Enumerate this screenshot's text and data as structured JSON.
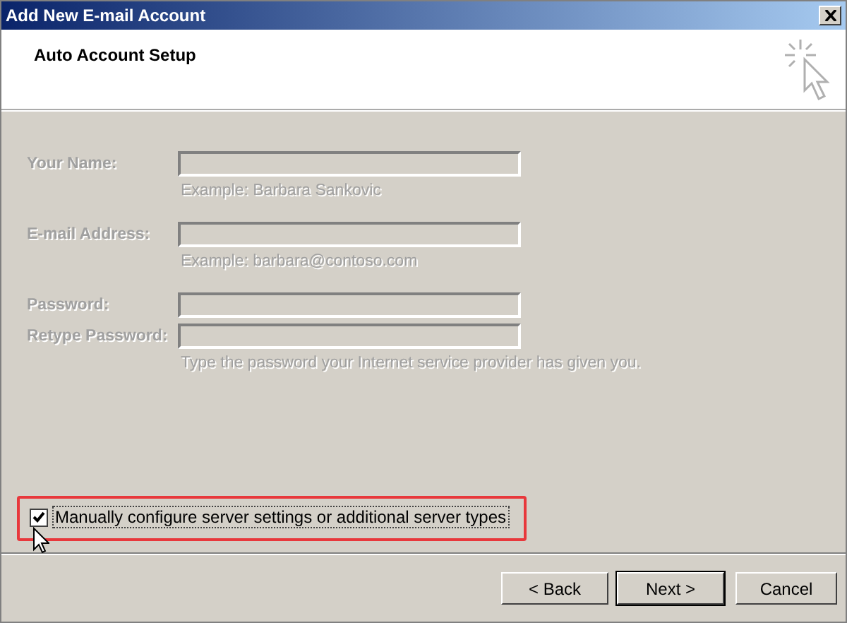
{
  "window": {
    "title": "Add New E-mail Account"
  },
  "header": {
    "title": "Auto Account Setup"
  },
  "form": {
    "disabled": true,
    "fields": [
      {
        "label": "Your Name:",
        "hint": "Example: Barbara Sankovic"
      },
      {
        "label": "E-mail Address:",
        "hint": "Example: barbara@contoso.com"
      },
      {
        "label": "Password:"
      },
      {
        "label": "Retype Password:",
        "hint": "Type the password your Internet service provider has given you."
      }
    ]
  },
  "manual_config": {
    "label": "Manually configure server settings or additional server types",
    "checked": true,
    "highlighted": true
  },
  "buttons": [
    {
      "label": "< Back",
      "default": false
    },
    {
      "label": "Next >",
      "default": true
    },
    {
      "label": "Cancel",
      "default": false
    }
  ]
}
